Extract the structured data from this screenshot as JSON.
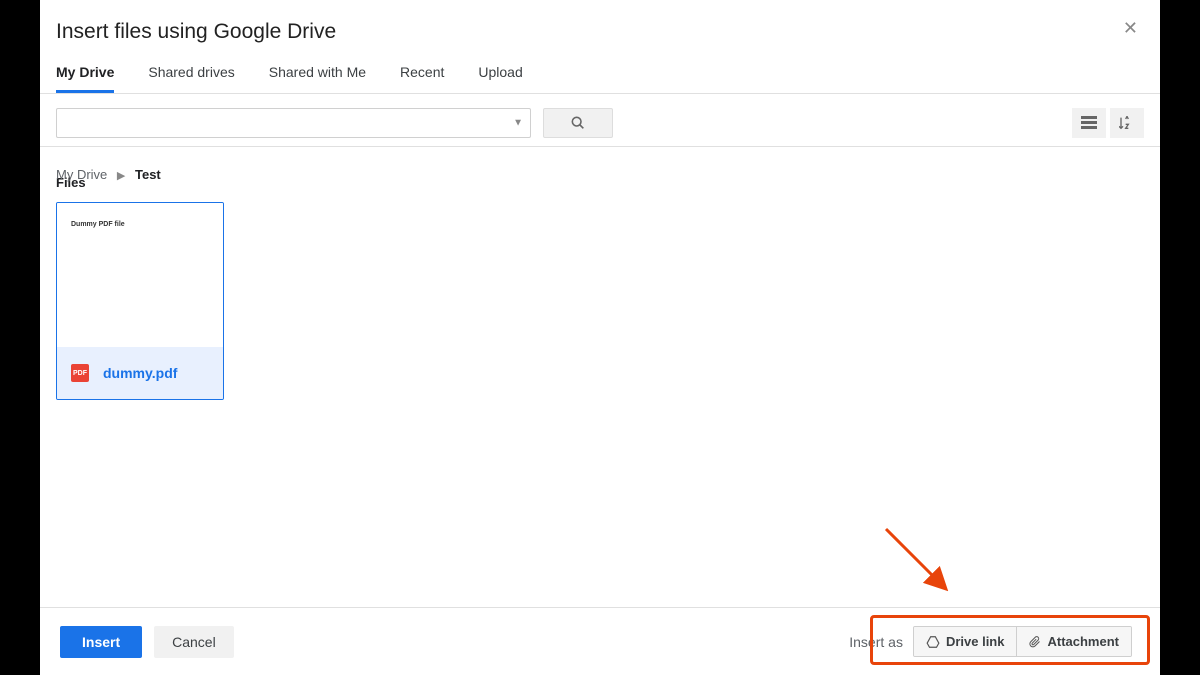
{
  "dialog": {
    "title": "Insert files using Google Drive"
  },
  "tabs": {
    "items": [
      {
        "label": "My Drive",
        "active": true
      },
      {
        "label": "Shared drives",
        "active": false
      },
      {
        "label": "Shared with Me",
        "active": false
      },
      {
        "label": "Recent",
        "active": false
      },
      {
        "label": "Upload",
        "active": false
      }
    ]
  },
  "search": {
    "value": "",
    "placeholder": ""
  },
  "breadcrumb": {
    "root": "My Drive",
    "current": "Test"
  },
  "section": {
    "files_label": "Files"
  },
  "file": {
    "preview_text": "Dummy PDF file",
    "badge": "PDF",
    "name": "dummy.pdf"
  },
  "footer": {
    "insert": "Insert",
    "cancel": "Cancel",
    "insert_as": "Insert as",
    "drive_link": "Drive link",
    "attachment": "Attachment"
  }
}
